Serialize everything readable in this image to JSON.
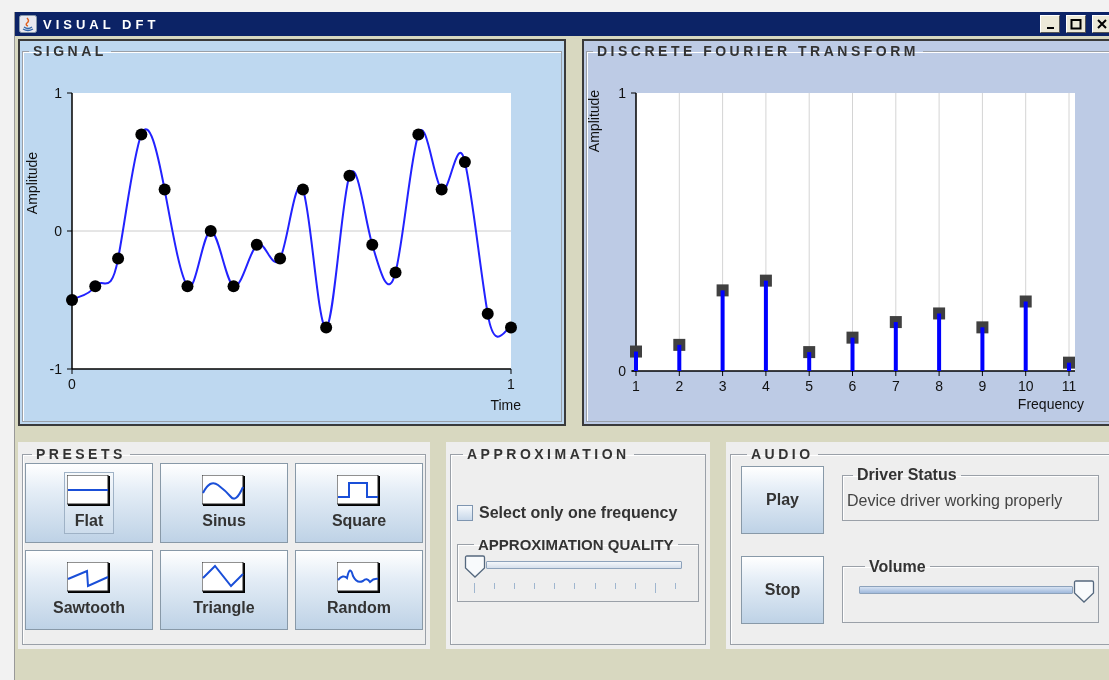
{
  "window": {
    "title": "VISUAL DFT"
  },
  "signal_panel": {
    "title": "SIGNAL",
    "chart_data": {
      "type": "line",
      "xlabel": "Time",
      "ylabel": "Amplitude",
      "x": [
        0,
        0.053,
        0.105,
        0.158,
        0.211,
        0.263,
        0.316,
        0.368,
        0.421,
        0.474,
        0.526,
        0.579,
        0.632,
        0.684,
        0.737,
        0.789,
        0.842,
        0.895,
        0.947,
        1
      ],
      "series": [
        {
          "color": "#2222ff",
          "marker": "circle",
          "values": [
            -0.5,
            -0.4,
            -0.2,
            0.7,
            0.3,
            -0.4,
            0,
            -0.4,
            -0.1,
            -0.2,
            0.3,
            -0.7,
            0.4,
            -0.1,
            -0.3,
            0.7,
            0.3,
            0.5,
            -0.6,
            -0.7
          ]
        }
      ],
      "xlim": [
        0,
        1
      ],
      "ylim": [
        -1,
        1
      ],
      "xticks": [
        0,
        1
      ],
      "yticks": [
        -1,
        0,
        1
      ]
    }
  },
  "dft_panel": {
    "title": "DISCRETE FOURIER TRANSFORM",
    "chart_data": {
      "type": "bar",
      "xlabel": "Frequency",
      "ylabel": "Amplitude",
      "categories": [
        "1",
        "2",
        "3",
        "4",
        "5",
        "6",
        "7",
        "8",
        "9",
        "10",
        "11"
      ],
      "series": [
        {
          "color": "#0000ff",
          "values": [
            0.07,
            0.094,
            0.29,
            0.325,
            0.068,
            0.12,
            0.176,
            0.207,
            0.157,
            0.25,
            0.03
          ]
        }
      ],
      "ylim": [
        0,
        1
      ],
      "yticks": [
        0,
        1
      ],
      "grid": true
    }
  },
  "presets": {
    "title": "PRESETS",
    "buttons": [
      {
        "label": "Flat",
        "kind": "flat",
        "focused": true
      },
      {
        "label": "Sinus",
        "kind": "sinus",
        "focused": false
      },
      {
        "label": "Square",
        "kind": "square",
        "focused": false
      },
      {
        "label": "Sawtooth",
        "kind": "sawtooth",
        "focused": false
      },
      {
        "label": "Triangle",
        "kind": "triangle",
        "focused": false
      },
      {
        "label": "Random",
        "kind": "random",
        "focused": false
      }
    ]
  },
  "approximation": {
    "title": "APPROXIMATION",
    "checkbox": {
      "label": "Select only one frequency",
      "checked": false
    },
    "quality": {
      "title": "APPROXIMATION QUALITY",
      "level": 0
    }
  },
  "audio": {
    "title": "AUDIO",
    "buttons": [
      "Play",
      "Stop"
    ],
    "driver_status": {
      "title": "Driver Status",
      "text": "Device driver working properly"
    },
    "volume": {
      "title": "Volume",
      "level": 1
    }
  }
}
